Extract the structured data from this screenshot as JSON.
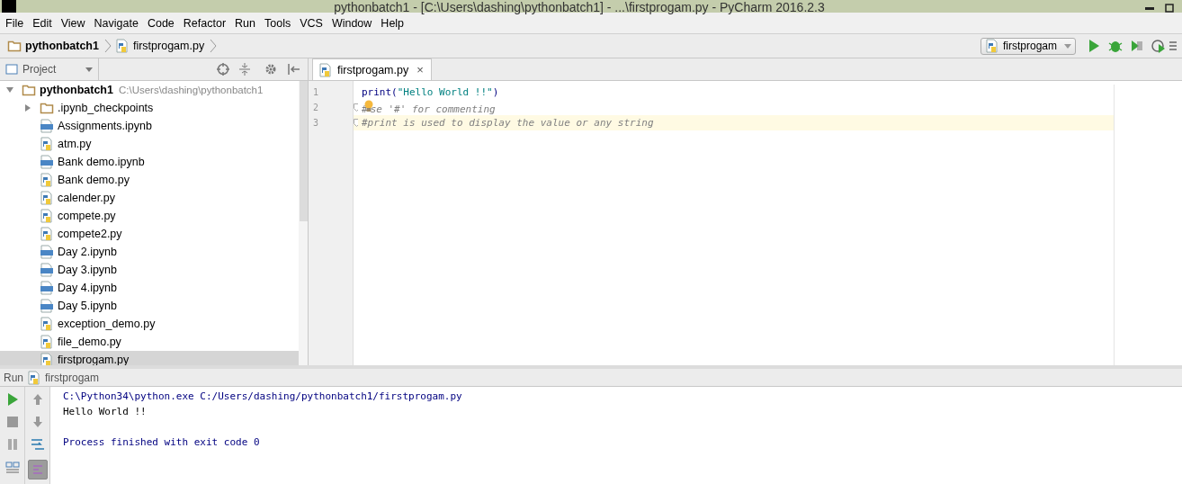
{
  "window": {
    "title": "pythonbatch1 - [C:\\Users\\dashing\\pythonbatch1] - ...\\firstprogam.py - PyCharm 2016.2.3"
  },
  "menu": [
    "File",
    "Edit",
    "View",
    "Navigate",
    "Code",
    "Refactor",
    "Run",
    "Tools",
    "VCS",
    "Window",
    "Help"
  ],
  "breadcrumbs": [
    {
      "kind": "folder",
      "label": "pythonbatch1"
    },
    {
      "kind": "py",
      "label": "firstprogam.py"
    }
  ],
  "run_config": {
    "label": "firstprogam"
  },
  "project_panel": {
    "title": "Project",
    "tree": [
      {
        "kind": "folder",
        "label": "pythonbatch1",
        "path": "C:\\Users\\dashing\\pythonbatch1",
        "expanded": true,
        "selected": false,
        "children": [
          {
            "kind": "folder",
            "label": ".ipynb_checkpoints",
            "expanded": false,
            "selected": false
          },
          {
            "kind": "ipynb",
            "label": "Assignments.ipynb",
            "selected": false
          },
          {
            "kind": "py",
            "label": "atm.py",
            "selected": false
          },
          {
            "kind": "ipynb",
            "label": "Bank demo.ipynb",
            "selected": false
          },
          {
            "kind": "py",
            "label": "Bank demo.py",
            "selected": false
          },
          {
            "kind": "py",
            "label": "calender.py",
            "selected": false
          },
          {
            "kind": "py",
            "label": "compete.py",
            "selected": false
          },
          {
            "kind": "py",
            "label": "compete2.py",
            "selected": false
          },
          {
            "kind": "ipynb",
            "label": "Day 2.ipynb",
            "selected": false
          },
          {
            "kind": "ipynb",
            "label": "Day 3.ipynb",
            "selected": false
          },
          {
            "kind": "ipynb",
            "label": "Day 4.ipynb",
            "selected": false
          },
          {
            "kind": "ipynb",
            "label": "Day 5.ipynb",
            "selected": false
          },
          {
            "kind": "py",
            "label": "exception_demo.py",
            "selected": false
          },
          {
            "kind": "py",
            "label": "file_demo.py",
            "selected": false
          },
          {
            "kind": "py",
            "label": "firstprogam.py",
            "selected": true
          }
        ]
      }
    ]
  },
  "editor": {
    "tabs": [
      {
        "label": "firstprogam.py",
        "close": "×",
        "selected": true
      }
    ],
    "lines": [
      {
        "number": "1",
        "current": false,
        "fold": false,
        "tokens": [
          {
            "kind": "call",
            "text": "print("
          },
          {
            "kind": "string",
            "text": "\"Hello World !!\""
          },
          {
            "kind": "call",
            "text": ")"
          }
        ]
      },
      {
        "number": "2",
        "current": false,
        "fold": true,
        "tokens": [
          {
            "kind": "comment",
            "text": "#"
          },
          {
            "kind": "bulb"
          },
          {
            "kind": "comment",
            "text": "se '#' for commenting"
          }
        ]
      },
      {
        "number": "3",
        "current": true,
        "fold": true,
        "tokens": [
          {
            "kind": "comment",
            "text": "#print is used to display the value or any string"
          }
        ]
      }
    ]
  },
  "run_panel": {
    "label": "Run",
    "config": "firstprogam",
    "scroll_to_end": true,
    "output": [
      {
        "kind": "command",
        "text": "C:\\Python34\\python.exe C:/Users/dashing/pythonbatch1/firstprogam.py"
      },
      {
        "kind": "output",
        "text": "Hello World !!"
      },
      {
        "kind": "blank"
      },
      {
        "kind": "status",
        "text": "Process finished with exit code 0"
      }
    ]
  }
}
